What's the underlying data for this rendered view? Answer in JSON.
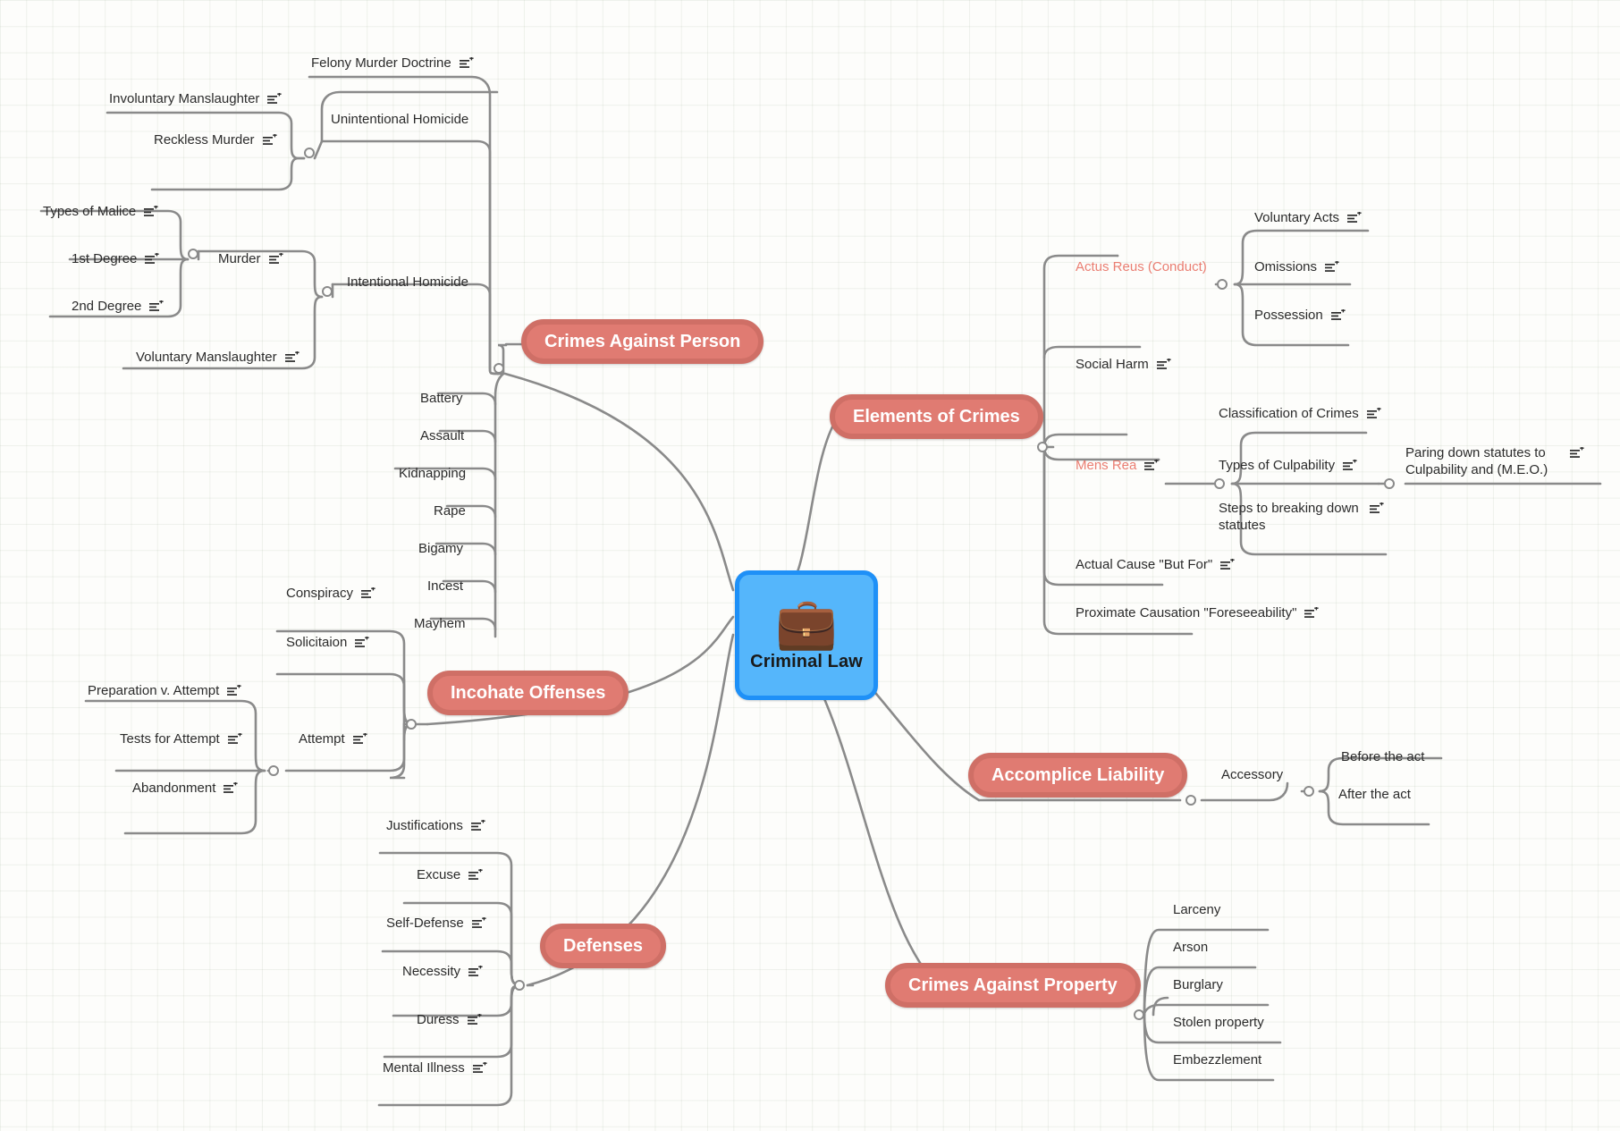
{
  "board": {
    "background_color": "#fdfdfb",
    "grid_color": "#e3e9df",
    "wire_color": "#8a8a8a",
    "accent_color": "#e07b72",
    "accent_text_color": "#ea7e72",
    "center_fill": "#55b6fb",
    "center_border": "#1e90f7"
  },
  "center": {
    "label": "Criminal Law",
    "icon": "briefcase-emoji",
    "emoji": "💼"
  },
  "branches": {
    "crimes_against_person": {
      "label": "Crimes Against Person",
      "children": {
        "unintentional_homicide": {
          "label": "Unintentional Homicide",
          "has_note": false,
          "children": [
            {
              "label": "Involuntary Manslaughter",
              "has_note": true
            },
            {
              "label": "Reckless Murder",
              "has_note": true
            }
          ]
        },
        "felony_murder_doctrine": {
          "label": "Felony Murder Doctrine",
          "has_note": true
        },
        "intentional_homicide": {
          "label": "Intentional Homicide",
          "has_note": false,
          "children": [
            {
              "label": "Murder",
              "has_note": true,
              "children": [
                {
                  "label": "Types of Malice",
                  "has_note": true
                },
                {
                  "label": "1st Degree",
                  "has_note": true
                },
                {
                  "label": "2nd Degree",
                  "has_note": true
                }
              ]
            },
            {
              "label": "Voluntary Manslaughter",
              "has_note": true
            }
          ]
        },
        "offenses": [
          {
            "label": "Battery",
            "has_note": false
          },
          {
            "label": "Assault",
            "has_note": false
          },
          {
            "label": "Kidnapping",
            "has_note": false
          },
          {
            "label": "Rape",
            "has_note": false
          },
          {
            "label": "Bigamy",
            "has_note": false
          },
          {
            "label": "Incest",
            "has_note": false
          },
          {
            "label": "Mayhem",
            "has_note": false
          }
        ]
      }
    },
    "elements_of_crimes": {
      "label": "Elements of Crimes",
      "children": [
        {
          "label": "Actus Reus (Conduct)",
          "accent": true,
          "has_note": false,
          "children": [
            {
              "label": "Voluntary Acts",
              "has_note": true
            },
            {
              "label": "Omissions",
              "has_note": true
            },
            {
              "label": "Possession",
              "has_note": true
            }
          ]
        },
        {
          "label": "Social Harm",
          "has_note": true
        },
        {
          "label": "Mens Rea",
          "accent": true,
          "has_note": true,
          "children": [
            {
              "label": "Classification of Crimes",
              "has_note": true
            },
            {
              "label": "Types of Culpability",
              "has_note": true,
              "children": [
                {
                  "label": "Paring down statutes to Culpability and (M.E.O.)",
                  "has_note": true
                }
              ]
            },
            {
              "label": "Steps to breaking down statutes",
              "has_note": true
            }
          ]
        },
        {
          "label": "Actual Cause \"But For\"",
          "has_note": true
        },
        {
          "label": "Proximate Causation \"Foreseeability\"",
          "has_note": true
        }
      ]
    },
    "incohate_offenses": {
      "label": "Incohate Offenses",
      "children": [
        {
          "label": "Conspiracy",
          "has_note": true
        },
        {
          "label": "Solicitaion",
          "has_note": true
        },
        {
          "label": "Attempt",
          "has_note": true,
          "children": [
            {
              "label": "Preparation v. Attempt",
              "has_note": true
            },
            {
              "label": "Tests for Attempt",
              "has_note": true
            },
            {
              "label": "Abandonment",
              "has_note": true
            }
          ]
        }
      ]
    },
    "defenses": {
      "label": "Defenses",
      "children": [
        {
          "label": "Justifications",
          "has_note": true
        },
        {
          "label": "Excuse",
          "has_note": true
        },
        {
          "label": "Self-Defense",
          "has_note": true
        },
        {
          "label": "Necessity",
          "has_note": true
        },
        {
          "label": "Duress",
          "has_note": true
        },
        {
          "label": "Mental Illness",
          "has_note": true
        }
      ]
    },
    "accomplice_liability": {
      "label": "Accomplice Liability",
      "children": [
        {
          "label": "Accessory",
          "has_note": false,
          "children": [
            {
              "label": "Before the act",
              "has_note": false
            },
            {
              "label": "After the act",
              "has_note": false
            }
          ]
        }
      ]
    },
    "crimes_against_property": {
      "label": "Crimes Against Property",
      "children": [
        {
          "label": "Larceny",
          "has_note": false
        },
        {
          "label": "Arson",
          "has_note": false
        },
        {
          "label": "Burglary",
          "has_note": false
        },
        {
          "label": "Stolen property",
          "has_note": false
        },
        {
          "label": "Embezzlement",
          "has_note": false
        }
      ]
    }
  }
}
